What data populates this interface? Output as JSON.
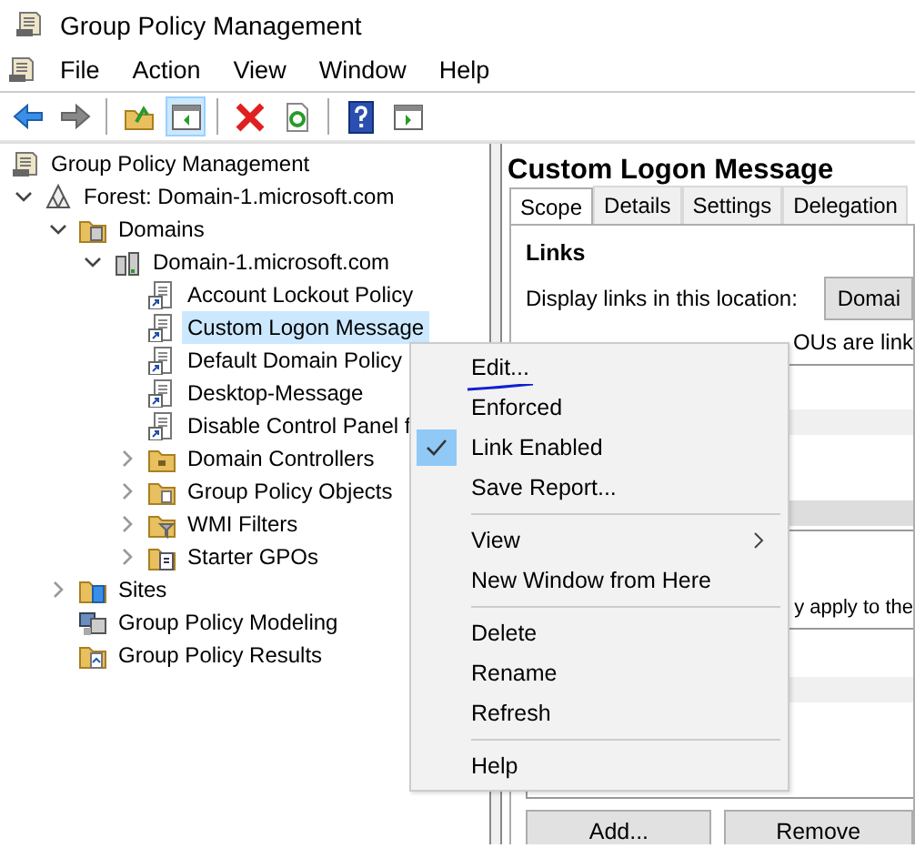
{
  "window": {
    "title": "Group Policy Management"
  },
  "menu_bar": [
    "File",
    "Action",
    "View",
    "Window",
    "Help"
  ],
  "toolbar": [
    {
      "kind": "back",
      "selected": false
    },
    {
      "kind": "forward",
      "selected": false
    },
    {
      "kind": "sep"
    },
    {
      "kind": "up",
      "selected": false
    },
    {
      "kind": "pane",
      "selected": true
    },
    {
      "kind": "sep"
    },
    {
      "kind": "delete",
      "selected": false
    },
    {
      "kind": "refresh",
      "selected": false
    },
    {
      "kind": "sep"
    },
    {
      "kind": "help",
      "selected": false
    },
    {
      "kind": "show",
      "selected": false
    }
  ],
  "tree": {
    "label": "Group Policy Management",
    "kind": "root",
    "selected": false,
    "children": [
      {
        "label": "Forest: Domain-1.microsoft.com",
        "kind": "forest",
        "expanded": true,
        "selected": false,
        "children": [
          {
            "label": "Domains",
            "kind": "domains",
            "expanded": true,
            "selected": false,
            "children": [
              {
                "label": "Domain-1.microsoft.com",
                "kind": "domain",
                "expanded": true,
                "selected": false,
                "children": [
                  {
                    "label": "Account Lockout Policy",
                    "kind": "gpo",
                    "selected": false
                  },
                  {
                    "label": "Custom Logon Message",
                    "kind": "gpo",
                    "selected": true
                  },
                  {
                    "label": "Default Domain Policy",
                    "kind": "gpo",
                    "selected": false
                  },
                  {
                    "label": "Desktop-Message",
                    "kind": "gpo",
                    "selected": false
                  },
                  {
                    "label": "Disable Control Panel f",
                    "kind": "gpo",
                    "selected": false
                  },
                  {
                    "label": "Domain Controllers",
                    "kind": "ou",
                    "expanded": false,
                    "selected": false
                  },
                  {
                    "label": "Group Policy Objects",
                    "kind": "folder",
                    "expanded": false,
                    "selected": false
                  },
                  {
                    "label": "WMI Filters",
                    "kind": "filter",
                    "expanded": false,
                    "selected": false
                  },
                  {
                    "label": "Starter GPOs",
                    "kind": "starter",
                    "expanded": false,
                    "selected": false
                  }
                ]
              }
            ]
          },
          {
            "label": "Sites",
            "kind": "sites",
            "expanded": false,
            "selected": false
          },
          {
            "label": "Group Policy Modeling",
            "kind": "modeling",
            "selected": false
          },
          {
            "label": "Group Policy Results",
            "kind": "results",
            "selected": false
          }
        ]
      }
    ]
  },
  "details": {
    "title": "Custom Logon Message",
    "tabs": [
      {
        "label": "Scope",
        "selected": true
      },
      {
        "label": "Details",
        "selected": false
      },
      {
        "label": "Settings",
        "selected": false
      },
      {
        "label": "Delegation",
        "selected": false
      }
    ],
    "links_heading": "Links",
    "location_label": "Display links in this location:",
    "location_value": "Domai",
    "links_text": "OUs are link",
    "filter_text": "y apply to the",
    "buttons": [
      "Add...",
      "Remove"
    ]
  },
  "context_menu": [
    {
      "kind": "item",
      "label": "Edit...",
      "checked": false,
      "underlined": true
    },
    {
      "kind": "item",
      "label": "Enforced",
      "checked": false,
      "underlined": false
    },
    {
      "kind": "item",
      "label": "Link Enabled",
      "checked": true,
      "underlined": false
    },
    {
      "kind": "item",
      "label": "Save Report...",
      "checked": false,
      "underlined": false
    },
    {
      "kind": "separator"
    },
    {
      "kind": "submenu",
      "label": "View",
      "checked": false,
      "underlined": false
    },
    {
      "kind": "item",
      "label": "New Window from Here",
      "checked": false,
      "underlined": false
    },
    {
      "kind": "separator"
    },
    {
      "kind": "item",
      "label": "Delete",
      "checked": false,
      "underlined": false
    },
    {
      "kind": "item",
      "label": "Rename",
      "checked": false,
      "underlined": false
    },
    {
      "kind": "item",
      "label": "Refresh",
      "checked": false,
      "underlined": false
    },
    {
      "kind": "separator"
    },
    {
      "kind": "item",
      "label": "Help",
      "checked": false,
      "underlined": false
    }
  ]
}
